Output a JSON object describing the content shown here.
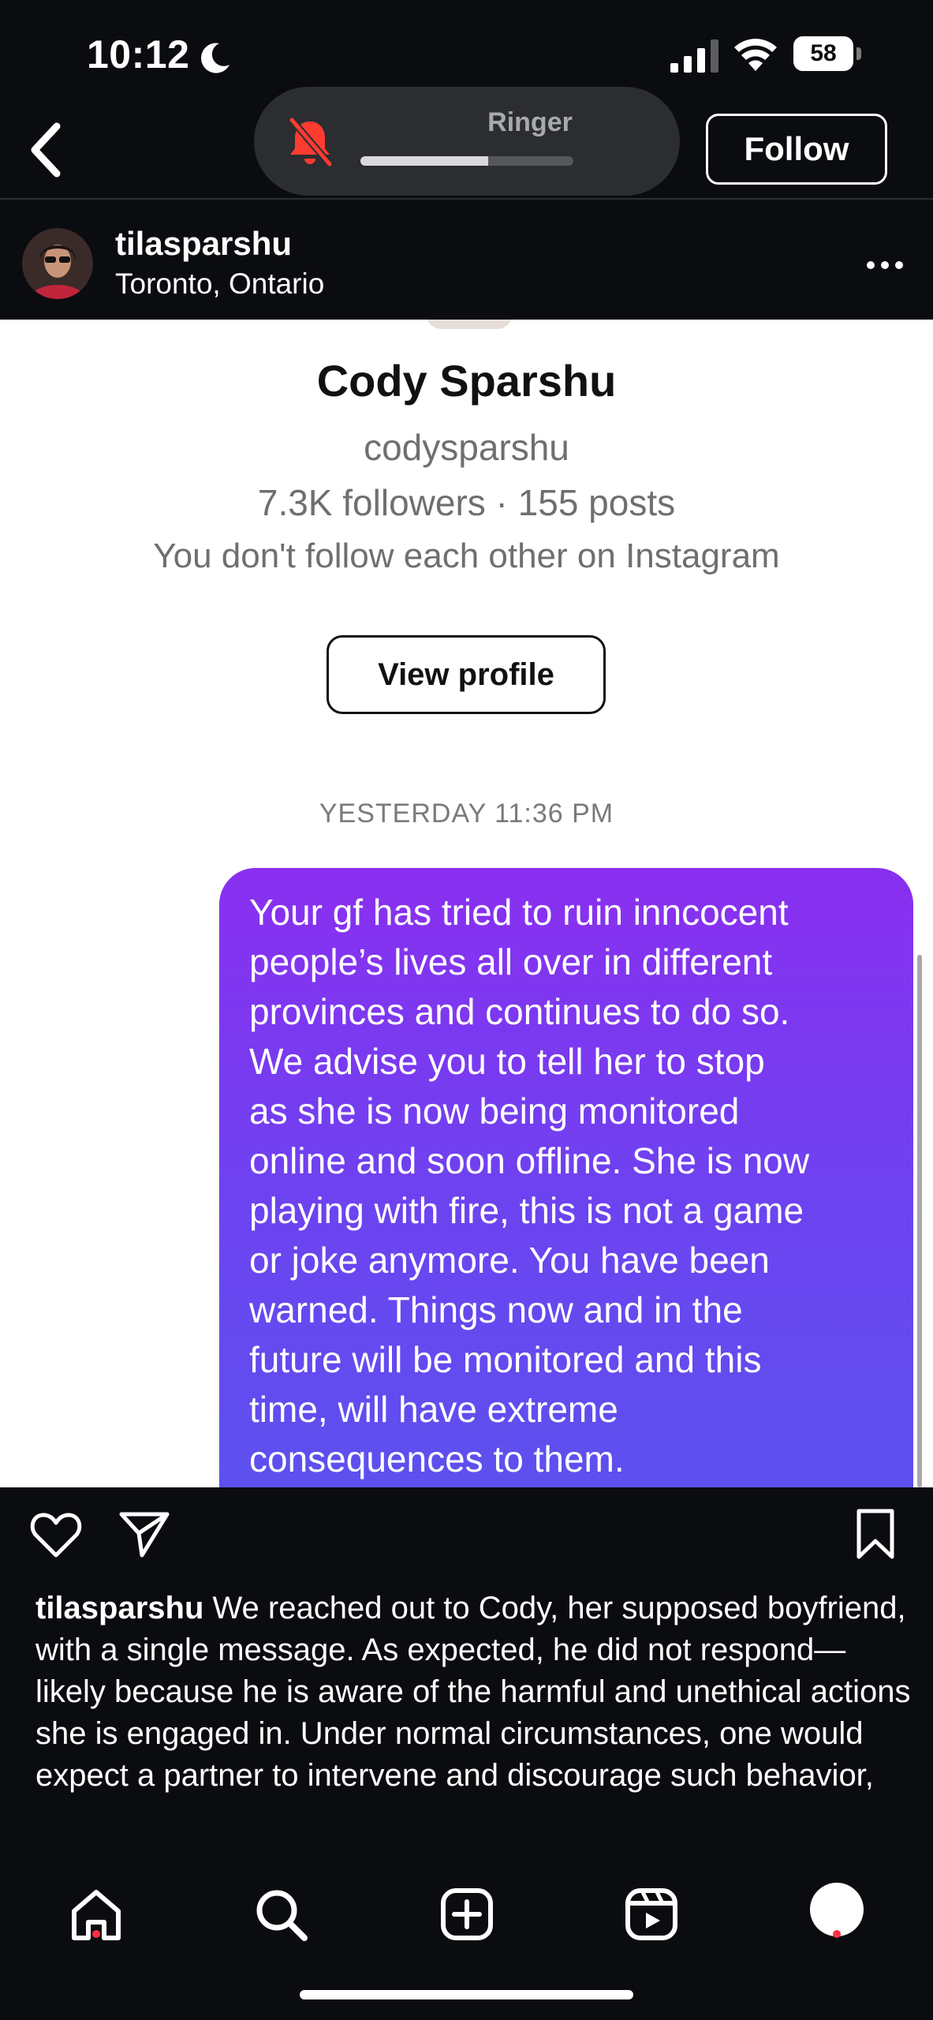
{
  "status_bar": {
    "time": "10:12",
    "battery": "58"
  },
  "header": {
    "ringer_label": "Ringer",
    "ringer_level": 0.6,
    "follow_label": "Follow"
  },
  "post": {
    "username": "tilasparshu",
    "location": "Toronto, Ontario"
  },
  "dm_screenshot": {
    "profile_name": "Cody Sparshu",
    "profile_handle": "codysparshu",
    "profile_stats": "7.3K followers · 155 posts",
    "relation": "You don't follow each other on Instagram",
    "view_profile_label": "View profile",
    "timestamp": "YESTERDAY 11:36 PM",
    "message": "Your gf has tried to ruin inncocent\npeople’s lives all over in different\nprovinces and continues to do so.\nWe advise you to tell her to stop\nas she is now being monitored\nonline and soon offline. She is now\nplaying with fire, this is not a game\nor joke anymore. You have been\nwarned. Things now and in the\nfuture will be monitored and this\ntime, will have extreme\nconsequences to them."
  },
  "caption": {
    "username": "tilasparshu",
    "text": " We reached out to Cody, her supposed boyfriend, with a single message. As expected, he did not respond—likely because he is aware of the harmful and unethical actions she is engaged in. Under normal circumstances, one would expect a partner to intervene and discourage such behavior,"
  },
  "colors": {
    "bubble_top": "#8a2ff0",
    "bubble_bottom": "#5b52ee",
    "notification_dot": "#ff3040"
  },
  "icons": {
    "actions": [
      "heart-icon",
      "share-icon",
      "bookmark-icon"
    ],
    "nav": [
      "home-icon",
      "search-icon",
      "create-icon",
      "reels-icon",
      "profile-avatar"
    ]
  }
}
